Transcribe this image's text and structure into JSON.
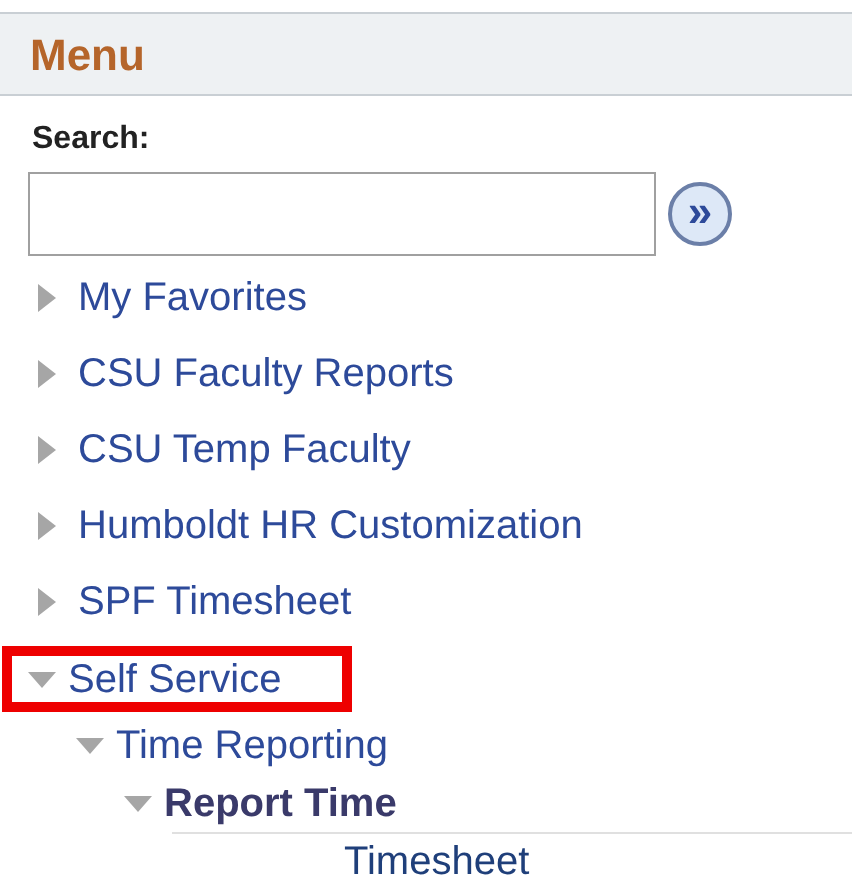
{
  "menu": {
    "title": "Menu"
  },
  "search": {
    "label": "Search:",
    "go_symbol": "»"
  },
  "tree": [
    {
      "label": "My Favorites",
      "kind": "folder",
      "expanded": false,
      "highlighted": false,
      "current": false
    },
    {
      "label": "CSU Faculty Reports",
      "kind": "folder",
      "expanded": false,
      "highlighted": false,
      "current": false
    },
    {
      "label": "CSU Temp Faculty",
      "kind": "folder",
      "expanded": false,
      "highlighted": false,
      "current": false
    },
    {
      "label": "Humboldt HR Customization",
      "kind": "folder",
      "expanded": false,
      "highlighted": false,
      "current": false
    },
    {
      "label": "SPF Timesheet",
      "kind": "folder",
      "expanded": false,
      "highlighted": false,
      "current": false
    },
    {
      "label": "Self Service",
      "kind": "folder",
      "expanded": true,
      "highlighted": true,
      "current": false,
      "children": [
        {
          "label": "Time Reporting",
          "kind": "folder",
          "expanded": true,
          "highlighted": false,
          "current": false,
          "children": [
            {
              "label": "Report Time",
              "kind": "folder",
              "expanded": true,
              "highlighted": false,
              "current": true,
              "children": [
                {
                  "label": "Timesheet",
                  "kind": "leaf"
                }
              ]
            }
          ]
        }
      ]
    }
  ]
}
